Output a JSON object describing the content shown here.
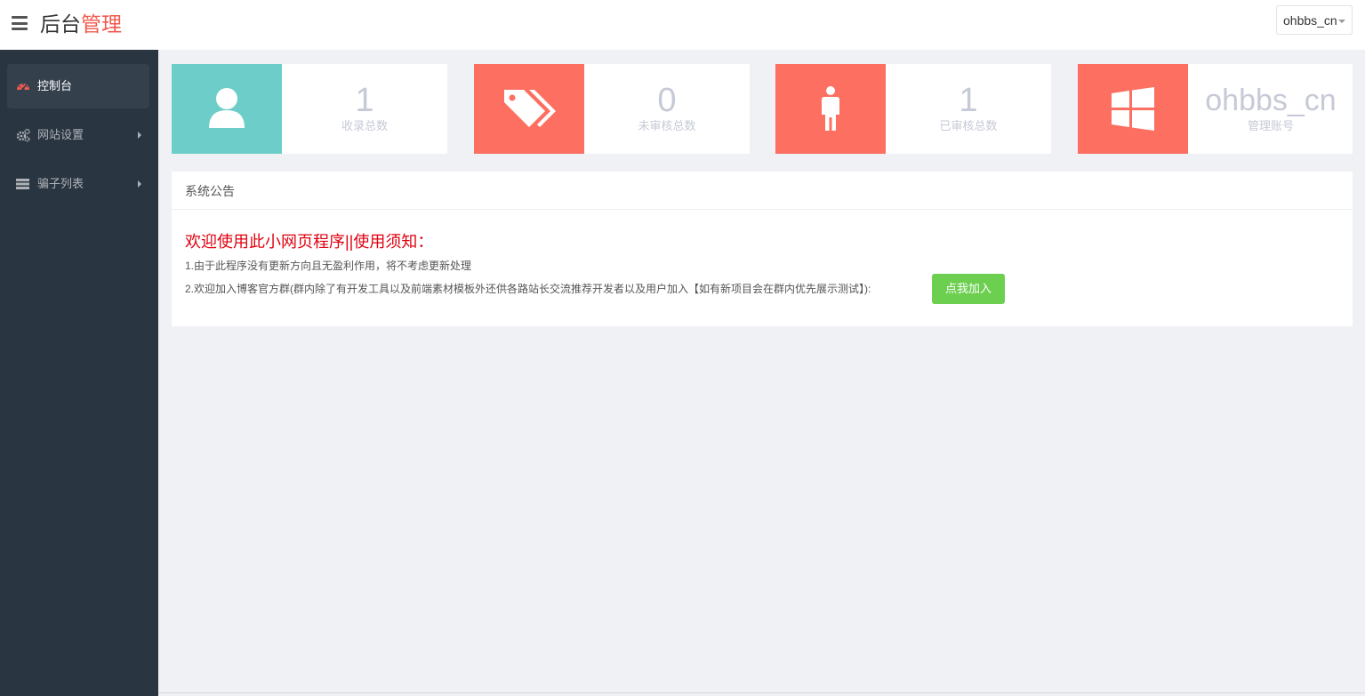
{
  "brand": {
    "part1": "后台",
    "part2": "管理",
    "accent_color": "#f05a4f"
  },
  "user_menu": {
    "label": "ohbbs_cn"
  },
  "sidebar": {
    "items": [
      {
        "label": "控制台",
        "icon": "dashboard-icon",
        "active": true
      },
      {
        "label": "网站设置",
        "icon": "gears-icon",
        "active": false
      },
      {
        "label": "骗子列表",
        "icon": "list-icon",
        "active": false
      }
    ]
  },
  "stats": [
    {
      "value": "1",
      "caption": "收录总数",
      "icon": "user-icon",
      "color": "#6dcdc8"
    },
    {
      "value": "0",
      "caption": "未审核总数",
      "icon": "tags-icon",
      "color": "#fc6f61"
    },
    {
      "value": "1",
      "caption": "已审核总数",
      "icon": "male-icon",
      "color": "#fc6f61"
    },
    {
      "value": "ohbbs_cn",
      "caption": "管理账号",
      "icon": "windows-icon",
      "color": "#fc6f61"
    }
  ],
  "notice": {
    "title": "系统公告",
    "heading": "欢迎使用此小网页程序||使用须知：",
    "line1": "1.由于此程序没有更新方向且无盈利作用，将不考虑更新处理",
    "line2": "2.欢迎加入博客官方群(群内除了有开发工具以及前端素材模板外还供各路站长交流推荐开发者以及用户加入【如有新项目会在群内优先展示测试】):",
    "join_label": "点我加入",
    "heading_color": "#e0000f",
    "button_color": "#6ccf4f"
  }
}
